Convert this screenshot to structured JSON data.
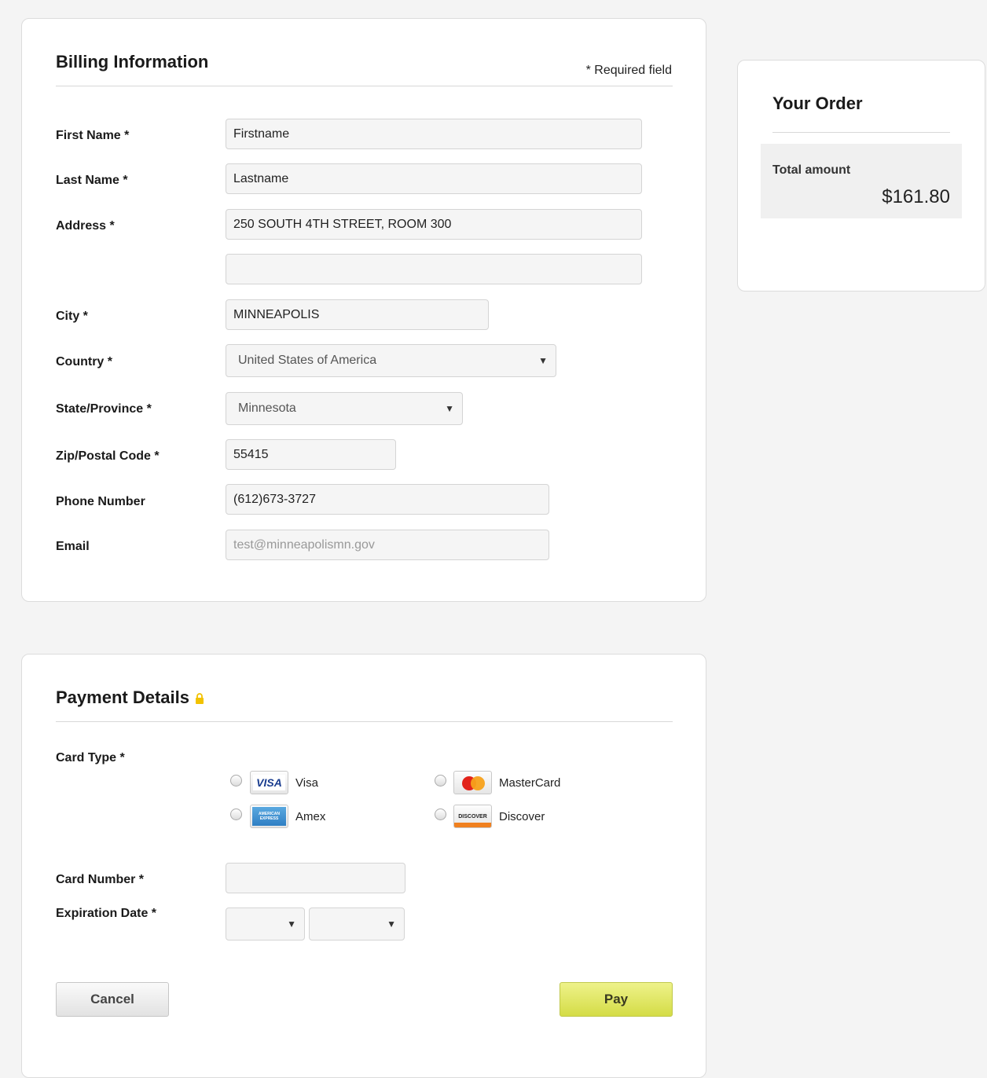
{
  "billing": {
    "title": "Billing Information",
    "required_note": "* Required field",
    "fields": {
      "first_name": {
        "label": "First Name *",
        "value": "Firstname"
      },
      "last_name": {
        "label": "Last Name *",
        "value": "Lastname"
      },
      "address": {
        "label": "Address *",
        "value": "250 SOUTH 4TH STREET, ROOM 300",
        "value2": ""
      },
      "city": {
        "label": "City *",
        "value": "MINNEAPOLIS"
      },
      "country": {
        "label": "Country *",
        "value": "United States of America"
      },
      "state": {
        "label": "State/Province *",
        "value": "Minnesota"
      },
      "zip": {
        "label": "Zip/Postal Code *",
        "value": "55415"
      },
      "phone": {
        "label": "Phone Number",
        "value": "(612)673-3727"
      },
      "email": {
        "label": "Email",
        "placeholder": "test@minneapolismn.gov"
      }
    }
  },
  "payment": {
    "title": "Payment Details",
    "lock_icon": "lock-icon",
    "card_type_label": "Card Type *",
    "card_types": {
      "visa": {
        "label": "Visa",
        "logo_text": "VISA"
      },
      "mastercard": {
        "label": "MasterCard",
        "logo_text": "MasterCard"
      },
      "amex": {
        "label": "Amex",
        "logo_text": "AMERICAN EXPRESS"
      },
      "discover": {
        "label": "Discover",
        "logo_text": "DISCOVER"
      }
    },
    "card_number_label": "Card Number *",
    "card_number_value": "",
    "expiration_label": "Expiration Date *",
    "expiration_month": "",
    "expiration_year": "",
    "cancel_label": "Cancel",
    "pay_label": "Pay",
    "colors": {
      "pay_button": "#d8df4e",
      "lock": "#f2c200"
    }
  },
  "order": {
    "title": "Your Order",
    "total_label": "Total amount",
    "total_value": "$161.80"
  }
}
